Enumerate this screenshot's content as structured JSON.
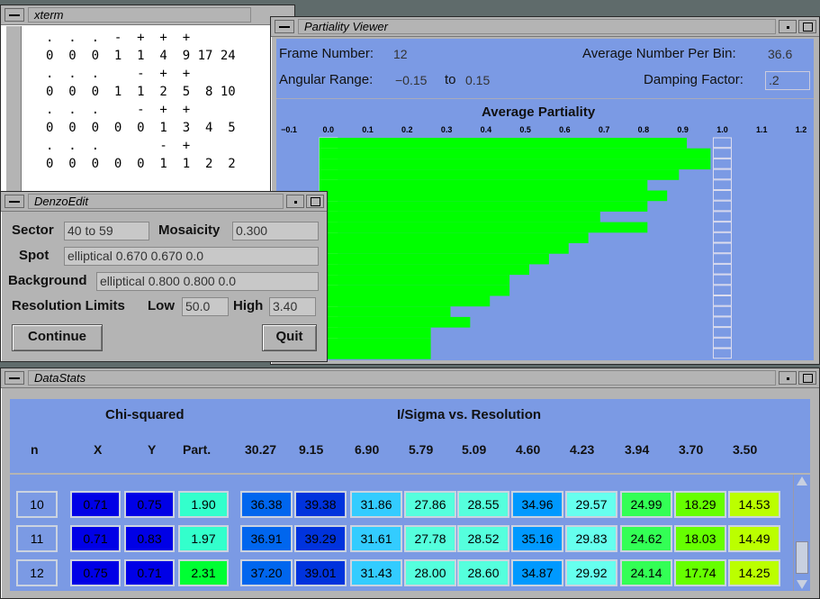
{
  "xterm": {
    "title": "xterm",
    "rows": [
      {
        "marks": ".  .  .  -  +  +  +",
        "nums": "0  0  0  1  1  4  9 17 24"
      },
      {
        "marks": ".  .  .     -  +  +",
        "nums": "0  0  0  1  1  2  5  8 10"
      },
      {
        "marks": ".  .  .     -  +  +",
        "nums": "0  0  0  0  0  1  3  4  5"
      },
      {
        "marks": ".  .  .        -  +",
        "nums": "0  0  0  0  0  1  1  2  2"
      }
    ]
  },
  "partiality": {
    "title": "Partiality Viewer",
    "frame_label": "Frame Number:",
    "frame_value": "12",
    "avg_bin_label": "Average Number Per Bin:",
    "avg_bin_value": "36.6",
    "angular_label": "Angular Range:",
    "angular_from": "−0.15",
    "angular_to_label": "to",
    "angular_to": "0.15",
    "damping_label": "Damping Factor:",
    "damping_value": ".2",
    "chart_title": "Average Partiality",
    "bar_color": "#00ff00",
    "bg_color": "#7b9ae4"
  },
  "chart_data": {
    "type": "bar",
    "orientation": "horizontal",
    "title": "Average Partiality",
    "tick_labels": [
      "−0.1",
      "0.0",
      "0.1",
      "0.2",
      "0.3",
      "0.4",
      "0.5",
      "0.6",
      "0.7",
      "0.8",
      "0.9",
      "1.0",
      "1.1",
      "1.2"
    ],
    "xlim": [
      -0.1,
      1.2
    ],
    "values": [
      0.91,
      0.97,
      0.97,
      0.89,
      0.81,
      0.86,
      0.81,
      0.69,
      0.81,
      0.66,
      0.61,
      0.56,
      0.51,
      0.46,
      0.46,
      0.41,
      0.31,
      0.36,
      0.26,
      0.26,
      0.26
    ]
  },
  "denzo": {
    "title": "DenzoEdit",
    "sector_label": "Sector",
    "sector_value": "40 to 59",
    "mosaicity_label": "Mosaicity",
    "mosaicity_value": "0.300",
    "spot_label": "Spot",
    "spot_value": "elliptical 0.670 0.670     0.0",
    "background_label": "Background",
    "background_value": "elliptical 0.800 0.800     0.0",
    "resolution_label": "Resolution Limits",
    "low_label": "Low",
    "low_value": "50.0",
    "high_label": "High",
    "high_value": "3.40",
    "continue_label": "Continue",
    "quit_label": "Quit"
  },
  "datastats": {
    "title": "DataStats",
    "chi_label": "Chi-squared",
    "isigma_label": "I/Sigma vs. Resolution",
    "col_n": "n",
    "col_x": "X",
    "col_y": "Y",
    "col_part": "Part.",
    "resolutions": [
      "30.27",
      "9.15",
      "6.90",
      "5.79",
      "5.09",
      "4.60",
      "4.23",
      "3.94",
      "3.70",
      "3.50"
    ],
    "rows": [
      {
        "n": "10",
        "x": "0.71",
        "y": "0.75",
        "part": "1.90",
        "vals": [
          "36.38",
          "39.38",
          "31.86",
          "27.86",
          "28.55",
          "34.96",
          "29.57",
          "24.99",
          "18.29",
          "14.53"
        ]
      },
      {
        "n": "11",
        "x": "0.71",
        "y": "0.83",
        "part": "1.97",
        "vals": [
          "36.91",
          "39.29",
          "31.61",
          "27.78",
          "28.52",
          "35.16",
          "29.83",
          "24.62",
          "18.03",
          "14.49"
        ]
      },
      {
        "n": "12",
        "x": "0.75",
        "y": "0.71",
        "part": "2.31",
        "vals": [
          "37.20",
          "39.01",
          "31.43",
          "28.00",
          "28.60",
          "34.87",
          "29.92",
          "24.14",
          "17.74",
          "14.25"
        ]
      }
    ],
    "colors": {
      "xy": "#0000e6",
      "part": "#33ffcc",
      "part_high": "#00ff33",
      "c36": "#0066ee",
      "c39": "#0033dd",
      "c31": "#33ccff",
      "c28": "#55ffdd",
      "c35": "#0099ff",
      "c29": "#66ffee",
      "c24": "#33ff55",
      "c18": "#66ff00",
      "c14": "#bbff00"
    }
  }
}
